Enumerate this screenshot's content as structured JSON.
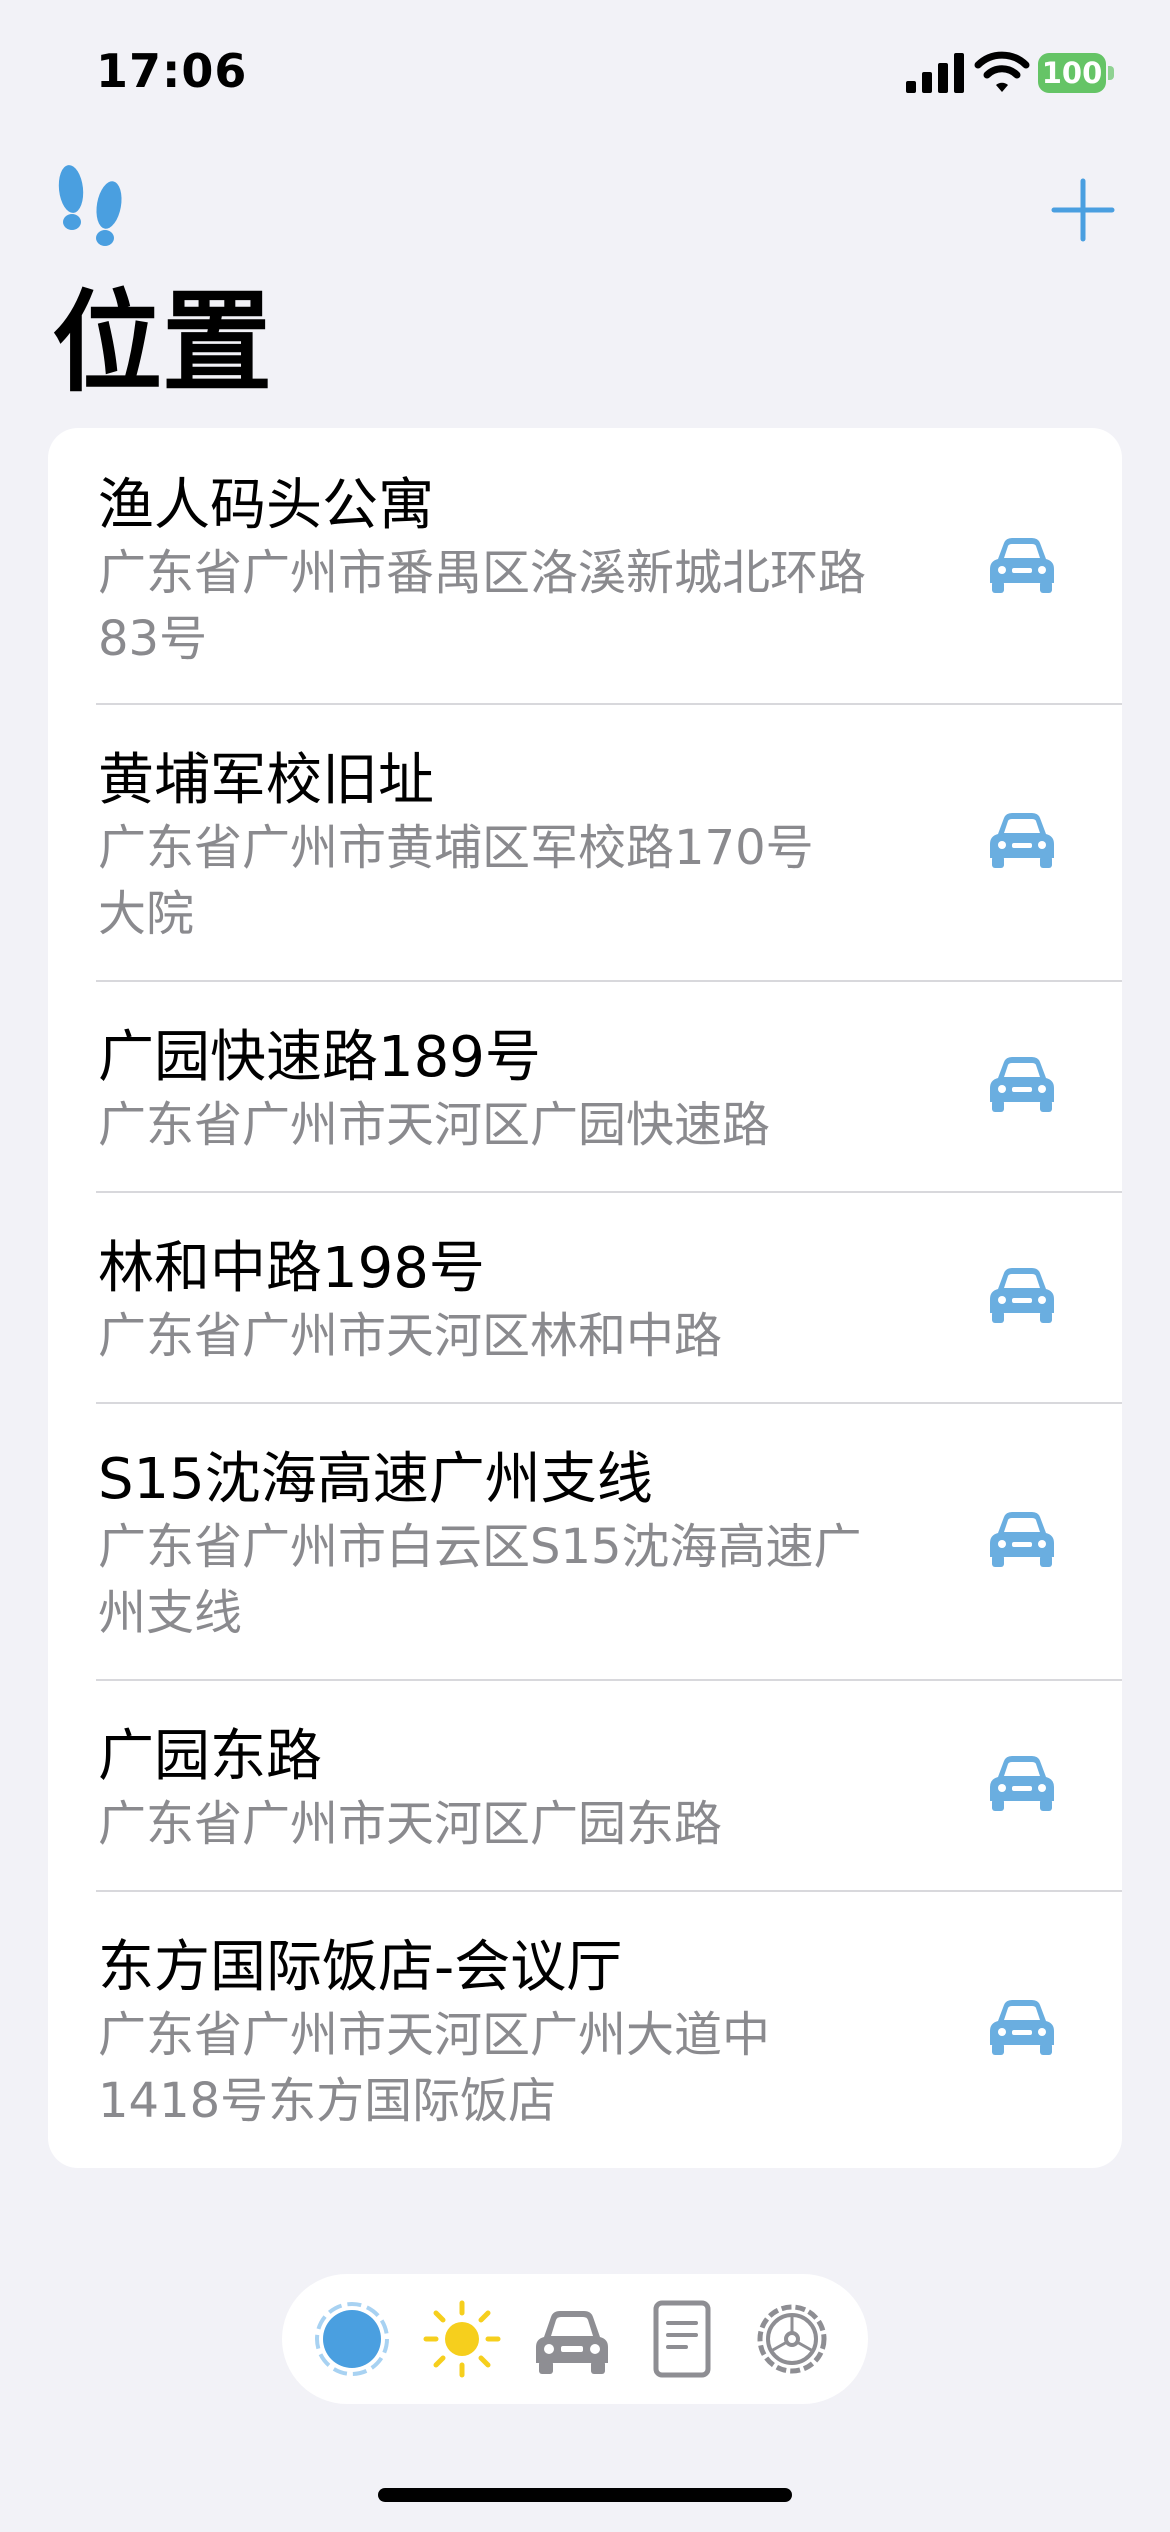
{
  "status_bar": {
    "time": "17:06",
    "battery": "100"
  },
  "header": {
    "title": "位置"
  },
  "locations": [
    {
      "title": "渔人码头公寓",
      "sub_lines": [
        "广东省广州市番禺区洛溪新城北环路",
        "83号"
      ]
    },
    {
      "title": "黄埔军校旧址",
      "sub_lines": [
        "广东省广州市黄埔区军校路170号",
        "大院"
      ]
    },
    {
      "title": "广园快速路189号",
      "sub_lines": [
        "广东省广州市天河区广园快速路"
      ]
    },
    {
      "title": "林和中路198号",
      "sub_lines": [
        "广东省广州市天河区林和中路"
      ]
    },
    {
      "title": "S15沈海高速广州支线",
      "sub_lines": [
        "广东省广州市白云区S15沈海高速广",
        "州支线"
      ]
    },
    {
      "title": "广园东路",
      "sub_lines": [
        "广东省广州市天河区广园东路"
      ]
    },
    {
      "title": "东方国际饭店-会议厅",
      "sub_lines": [
        "广东省广州市天河区广州大道中",
        "1418号东方国际饭店"
      ]
    }
  ],
  "tabs": [
    {
      "icon": "location-circle-icon",
      "selected": true
    },
    {
      "icon": "sun-icon",
      "selected": false
    },
    {
      "icon": "car-icon",
      "selected": false
    },
    {
      "icon": "document-icon",
      "selected": false
    },
    {
      "icon": "settings-gear-icon",
      "selected": false
    }
  ],
  "colors": {
    "accent": "#4a9fe0",
    "car": "#6aaee0",
    "sun": "#f6cf1d",
    "tab_gray": "#8e8e93",
    "battery": "#65c466"
  }
}
